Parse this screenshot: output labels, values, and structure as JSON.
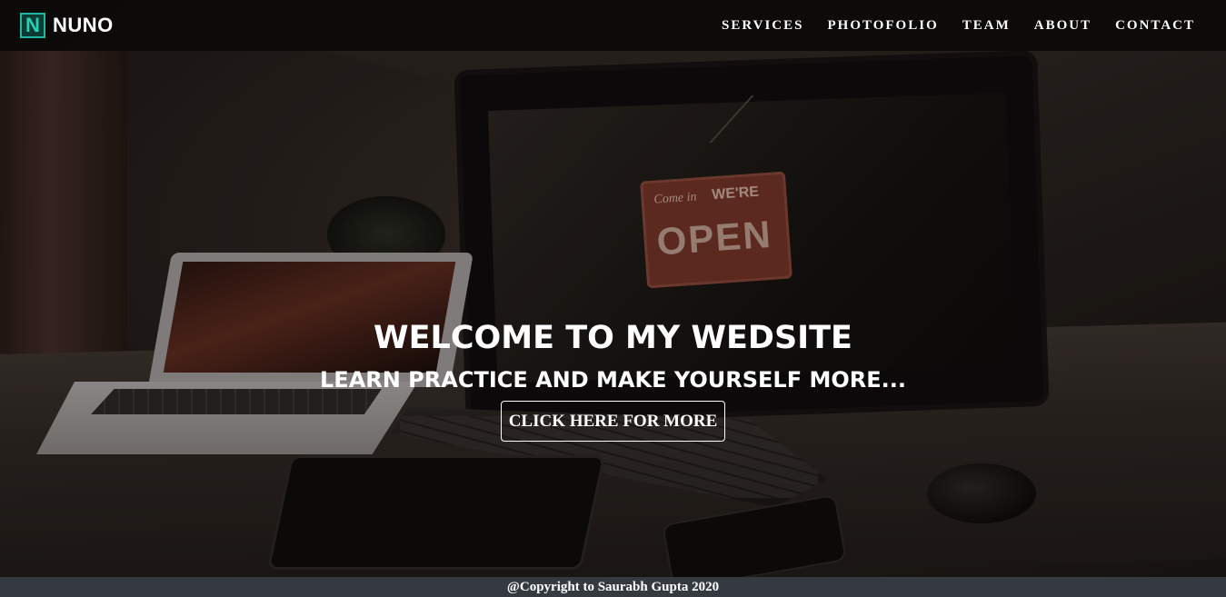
{
  "brand": {
    "logo_letter": "N",
    "name": "NUNO",
    "logo_icon": "n-logo-icon",
    "accent_color": "#25d0b4"
  },
  "nav": {
    "items": [
      {
        "label": "SERVICES"
      },
      {
        "label": "PHOTOFOLIO"
      },
      {
        "label": "TEAM"
      },
      {
        "label": "ABOUT"
      },
      {
        "label": "CONTACT"
      }
    ]
  },
  "hero": {
    "title": "WELCOME TO MY WEDSITE",
    "subtitle": "LEARN PRACTICE AND MAKE YOURSELF MORE...",
    "cta_label": "CLICK HERE FOR MORE",
    "background_image": "desk-with-laptop-monitor-keyboard-photo",
    "sign": {
      "line_a": "Come in",
      "line_b": "WE'RE",
      "line_c": "OPEN"
    }
  },
  "footer": {
    "text": "@Copyright to Saurabh Gupta 2020",
    "background_color": "#343a40"
  }
}
